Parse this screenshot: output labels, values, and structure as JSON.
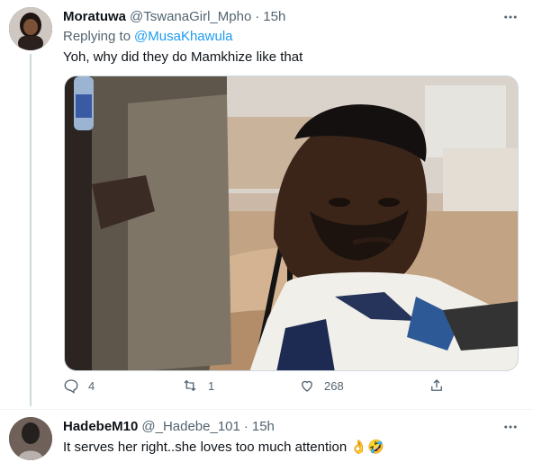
{
  "tweet1": {
    "display_name": "Moratuwa",
    "handle": "@TswanaGirl_Mpho",
    "dot": "·",
    "time": "15h",
    "replying_prefix": "Replying to",
    "replying_to": "@MusaKhawula",
    "text": "Yoh, why did they do Mamkhize like that",
    "more_icon": "more-horizontal-icon",
    "media_icon": "photo",
    "actions": {
      "replies": "4",
      "retweets": "1",
      "likes": "268"
    }
  },
  "tweet2": {
    "display_name": "HadebeM10",
    "handle": "@_Hadebe_101",
    "dot": "·",
    "time": "15h",
    "text": "It serves her right..she loves too much attention 👌🤣",
    "more_icon": "more-horizontal-icon"
  },
  "colors": {
    "link": "#1d9bf0",
    "secondary_text": "#536471",
    "primary_text": "#0f1419",
    "thread_line": "#cfd9de"
  }
}
